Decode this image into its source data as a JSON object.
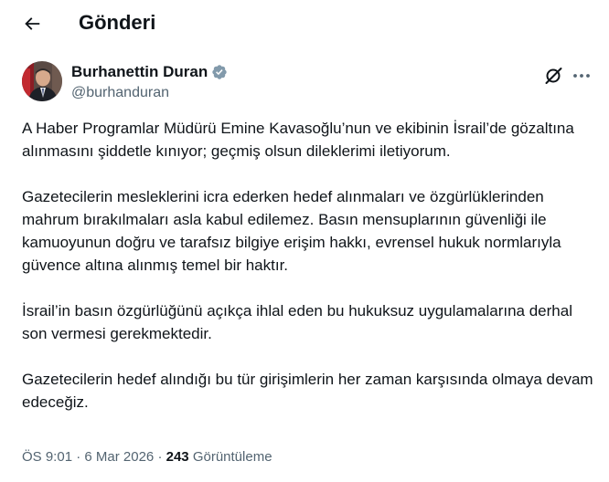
{
  "header": {
    "title": "Gönderi"
  },
  "author": {
    "display_name": "Burhanettin Duran",
    "handle": "@burhanduran"
  },
  "post": {
    "paragraphs": [
      "A Haber Programlar Müdürü Emine Kavasoğlu’nun ve ekibinin İsrail’de gözaltına alınmasını şiddetle kınıyor; geçmiş olsun dileklerimi iletiyorum.",
      "Gazetecilerin mesleklerini icra ederken hedef alınmaları ve özgürlüklerinden mahrum bırakılmaları asla kabul edilemez. Basın mensuplarının güvenliği ile kamuoyunun doğru ve tarafsız bilgiye erişim hakkı, evrensel hukuk normlarıyla güvence altına alınmış temel bir haktır.",
      "İsrail’in basın özgürlüğünü açıkça ihlal eden bu hukuksuz uygulamalarına derhal son vermesi gerekmektedir.",
      "Gazetecilerin hedef alındığı bu tür girişimlerin her zaman karşısında olmaya devam edeceğiz."
    ]
  },
  "meta": {
    "time": "ÖS 9:01",
    "separator": "·",
    "date": "6 Mar 2026",
    "views_count": "243",
    "views_label": "Görüntüleme"
  },
  "colors": {
    "text": "#0f1419",
    "secondary": "#536471",
    "verified": "#829aab"
  },
  "icons": {
    "back": "arrow-left-icon",
    "verified": "verified-badge-icon",
    "grok": "grok-icon",
    "more": "more-horizontal-icon"
  }
}
